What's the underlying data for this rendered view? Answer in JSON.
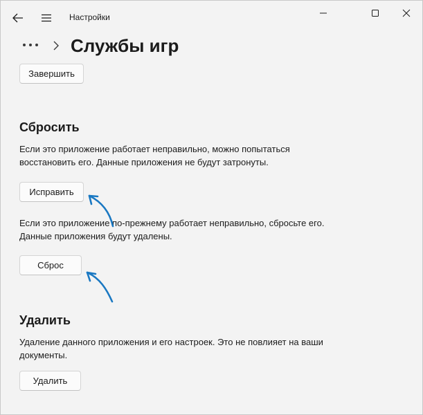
{
  "titlebar": {
    "app_title": "Настройки"
  },
  "header": {
    "title": "Службы игр"
  },
  "top_partial": {
    "finish_label": "Завершить"
  },
  "reset_section": {
    "title": "Сбросить",
    "repair_desc": "Если это приложение работает неправильно, можно попытаться восстановить его. Данные приложения не будут затронуты.",
    "repair_label": "Исправить",
    "reset_desc": "Если это приложение по-прежнему работает неправильно, сбросьте его. Данные приложения будут удалены.",
    "reset_label": "Сброс"
  },
  "uninstall_section": {
    "title": "Удалить",
    "desc": "Удаление данного приложения и его настроек. Это не повлияет на ваши документы.",
    "uninstall_label": "Удалить"
  },
  "colors": {
    "annotation_arrow": "#1a78c2",
    "background": "#f3f3f3"
  },
  "icons": [
    "back-arrow-icon",
    "hamburger-menu-icon",
    "minimize-icon",
    "maximize-icon",
    "close-icon",
    "more-icon",
    "chevron-right-icon"
  ]
}
